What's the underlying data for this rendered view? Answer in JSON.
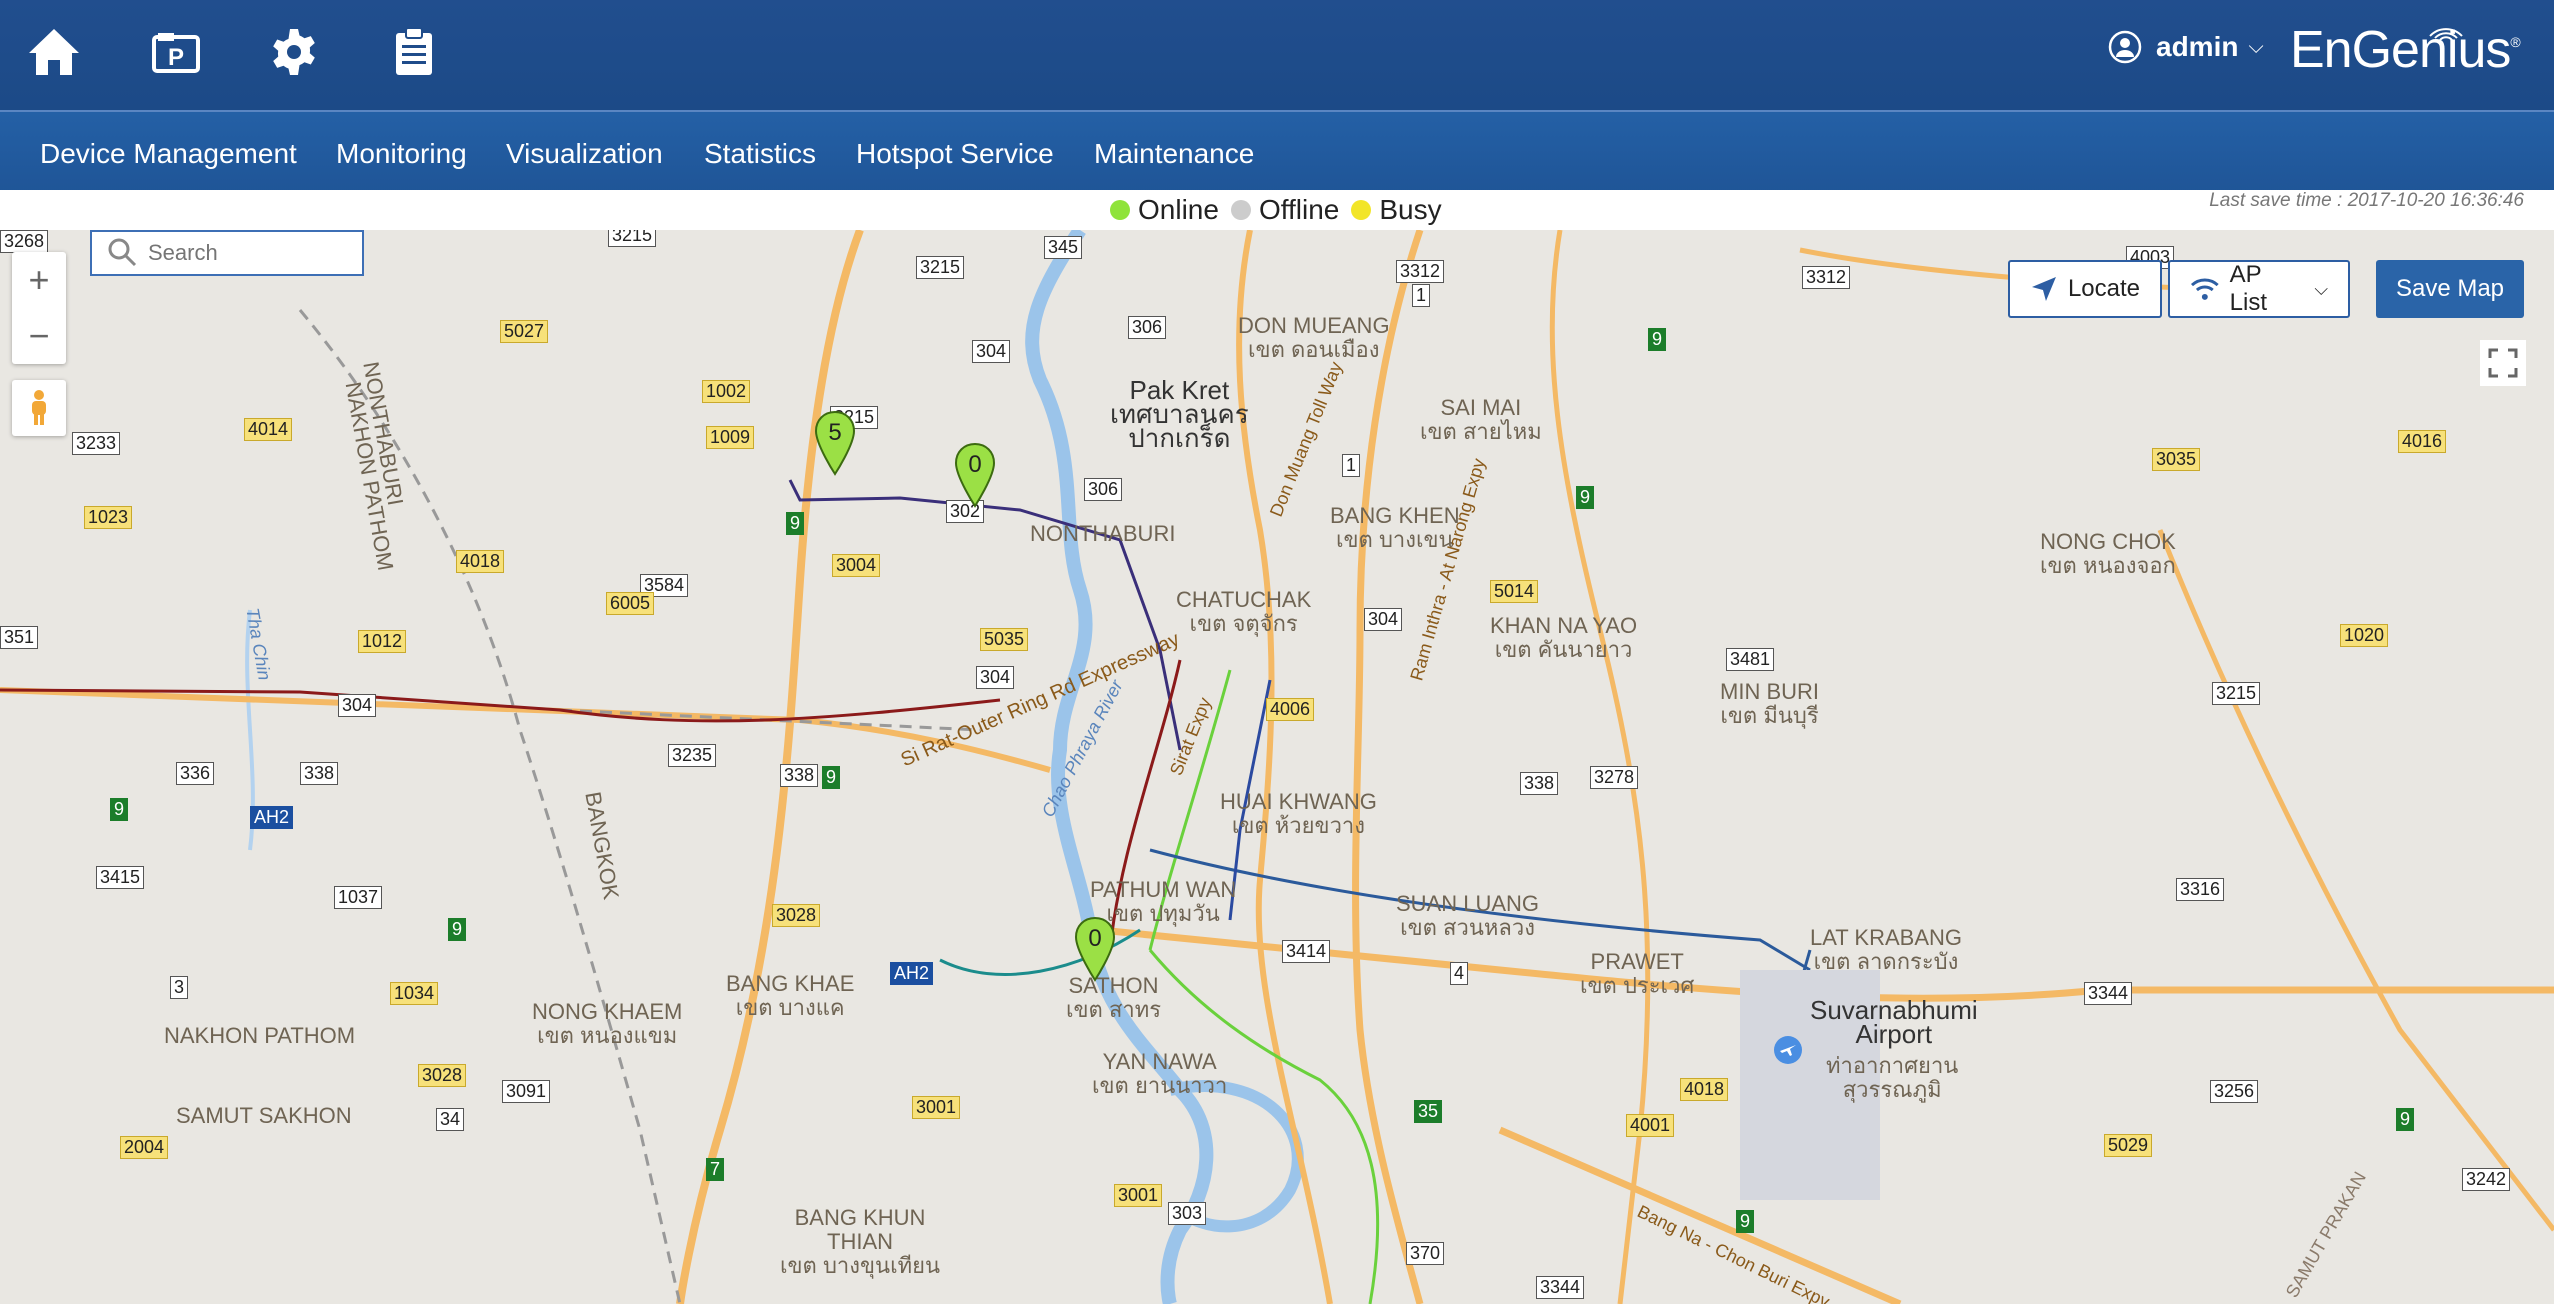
{
  "header": {
    "icons": [
      "home-icon",
      "parking-icon",
      "gear-icon",
      "clipboard-icon"
    ],
    "user": "admin",
    "brand": "EnGenius"
  },
  "nav": [
    "Device Management",
    "Monitoring",
    "Visualization",
    "Statistics",
    "Hotspot Service",
    "Maintenance"
  ],
  "legend": {
    "online": "Online",
    "offline": "Offline",
    "busy": "Busy",
    "colors": {
      "online": "#8fe33a",
      "offline": "#cccccc",
      "busy": "#f2e528"
    }
  },
  "last_save": "Last save time : 2017-10-20 16:36:46",
  "map": {
    "search_placeholder": "Search",
    "zoom_in": "+",
    "zoom_out": "−",
    "locate": "Locate",
    "ap_list": "AP List",
    "save_map": "Save Map",
    "markers": [
      "5",
      "0",
      "0"
    ],
    "places": {
      "don_mueang": "DON MUEANG",
      "don_mueang_th": "เขต ดอนเมือง",
      "pak_kret": "Pak Kret",
      "pak_kret_th1": "เทศบาลนคร",
      "pak_kret_th2": "ปากเกร็ด",
      "sai_mai": "SAI MAI",
      "sai_mai_th": "เขต สายไหม",
      "nonthaburi": "NONTHABURI",
      "bang_khen": "BANG KHEN",
      "bang_khen_th": "เขต บางเขน",
      "nong_chok": "NONG CHOK",
      "nong_chok_th": "เขต หนองจอก",
      "chatuchak": "CHATUCHAK",
      "chatuchak_th": "เขต จตุจักร",
      "khan_na_yao": "KHAN NA YAO",
      "khan_na_yao_th": "เขต คันนายาว",
      "min_buri": "MIN BURI",
      "min_buri_th": "เขต มีนบุรี",
      "huai_khwang": "HUAI KHWANG",
      "huai_khwang_th": "เขต ห้วยขวาง",
      "pathum_wan": "PATHUM WAN",
      "pathum_wan_th": "เขต ปทุมวัน",
      "suan_luang": "SUAN LUANG",
      "suan_luang_th": "เขต สวนหลวง",
      "lat_krabang": "LAT KRABANG",
      "lat_krabang_th": "เขต ลาดกระบัง",
      "prawet": "PRAWET",
      "prawet_th": "เขต ประเวศ",
      "suvarnabhumi": "Suvarnabhumi",
      "airport": "Airport",
      "airport_th1": "ท่าอากาศยาน",
      "airport_th2": "สุวรรณภูมิ",
      "bang_khae": "BANG KHAE",
      "bang_khae_th": "เขต บางแค",
      "nong_khaem": "NONG KHAEM",
      "nong_khaem_th": "เขต หนองแขม",
      "sathon": "SATHON",
      "sathon_th": "เขต สาทร",
      "yan_nawa": "YAN NAWA",
      "yan_nawa_th": "เขต ยานนาวา",
      "nakhon_pathom": "NAKHON PATHOM",
      "samut_sakhon": "SAMUT SAKHON",
      "bang_khun_thian": "BANG KHUN",
      "bang_khun_thian2": "THIAN",
      "bang_khun_thian_th": "เขต บางขุนเทียน",
      "nonthaburi_v": "NONTHABURI",
      "nakhon_pathom_v": "NAKHON PATHOM",
      "bangkok_v": "BANGKOK",
      "the_chin": "Tha Chin",
      "chao_phraya": "Chao Phraya River",
      "don_muang_tollway": "Don Muang Toll Way",
      "ram_inthra": "Ram Inthra - At Narong Expy",
      "si_rat": "Si Rat-Outer Ring Rd Expressway",
      "sirat_expy": "Sirat Expy",
      "bang_na": "Bang Na - Chon Buri Expy",
      "samut_prakan": "SAMUT PRAKAN"
    },
    "road_badges": [
      {
        "t": "3215",
        "c": "w"
      },
      {
        "t": "345",
        "c": "w"
      },
      {
        "t": "3215",
        "c": "w"
      },
      {
        "t": "3312",
        "c": "w"
      },
      {
        "t": "1",
        "c": "w"
      },
      {
        "t": "3312",
        "c": "w"
      },
      {
        "t": "4003",
        "c": "w"
      },
      {
        "t": "5027",
        "c": "y"
      },
      {
        "t": "304",
        "c": "w"
      },
      {
        "t": "306",
        "c": "w"
      },
      {
        "t": "9",
        "c": "g"
      },
      {
        "t": "1002",
        "c": "y"
      },
      {
        "t": "3215",
        "c": "w"
      },
      {
        "t": "4014",
        "c": "y"
      },
      {
        "t": "1009",
        "c": "y"
      },
      {
        "t": "3233",
        "c": "w"
      },
      {
        "t": "1",
        "c": "w"
      },
      {
        "t": "4016",
        "c": "y"
      },
      {
        "t": "3035",
        "c": "y"
      },
      {
        "t": "306",
        "c": "w"
      },
      {
        "t": "302",
        "c": "w"
      },
      {
        "t": "9",
        "c": "g"
      },
      {
        "t": "9",
        "c": "g"
      },
      {
        "t": "1023",
        "c": "y"
      },
      {
        "t": "4018",
        "c": "y"
      },
      {
        "t": "3004",
        "c": "y"
      },
      {
        "t": "3584",
        "c": "w"
      },
      {
        "t": "6005",
        "c": "y"
      },
      {
        "t": "5014",
        "c": "y"
      },
      {
        "t": "304",
        "c": "w"
      },
      {
        "t": "351",
        "c": "w"
      },
      {
        "t": "1012",
        "c": "y"
      },
      {
        "t": "5035",
        "c": "y"
      },
      {
        "t": "1020",
        "c": "y"
      },
      {
        "t": "3481",
        "c": "w"
      },
      {
        "t": "304",
        "c": "w"
      },
      {
        "t": "3215",
        "c": "w"
      },
      {
        "t": "304",
        "c": "w"
      },
      {
        "t": "4006",
        "c": "y"
      },
      {
        "t": "336",
        "c": "w"
      },
      {
        "t": "338",
        "c": "w"
      },
      {
        "t": "3235",
        "c": "w"
      },
      {
        "t": "338",
        "c": "w"
      },
      {
        "t": "9",
        "c": "g"
      },
      {
        "t": "338",
        "c": "w"
      },
      {
        "t": "3278",
        "c": "w"
      },
      {
        "t": "9",
        "c": "g"
      },
      {
        "t": "AH2",
        "c": "b"
      },
      {
        "t": "3415",
        "c": "w"
      },
      {
        "t": "1037",
        "c": "w"
      },
      {
        "t": "3316",
        "c": "w"
      },
      {
        "t": "3028",
        "c": "y"
      },
      {
        "t": "9",
        "c": "g"
      },
      {
        "t": "3414",
        "c": "w"
      },
      {
        "t": "3",
        "c": "w"
      },
      {
        "t": "1034",
        "c": "y"
      },
      {
        "t": "AH2",
        "c": "b"
      },
      {
        "t": "4",
        "c": "w"
      },
      {
        "t": "3344",
        "c": "w"
      },
      {
        "t": "3028",
        "c": "y"
      },
      {
        "t": "3091",
        "c": "w"
      },
      {
        "t": "4018",
        "c": "y"
      },
      {
        "t": "3256",
        "c": "w"
      },
      {
        "t": "3001",
        "c": "y"
      },
      {
        "t": "35",
        "c": "g"
      },
      {
        "t": "34",
        "c": "w"
      },
      {
        "t": "4001",
        "c": "y"
      },
      {
        "t": "9",
        "c": "g"
      },
      {
        "t": "2004",
        "c": "y"
      },
      {
        "t": "5029",
        "c": "y"
      },
      {
        "t": "7",
        "c": "g"
      },
      {
        "t": "3242",
        "c": "w"
      },
      {
        "t": "3001",
        "c": "y"
      },
      {
        "t": "303",
        "c": "w"
      },
      {
        "t": "9",
        "c": "g"
      },
      {
        "t": "370",
        "c": "w"
      },
      {
        "t": "3344",
        "c": "w"
      },
      {
        "t": "3268",
        "c": "w"
      }
    ]
  }
}
